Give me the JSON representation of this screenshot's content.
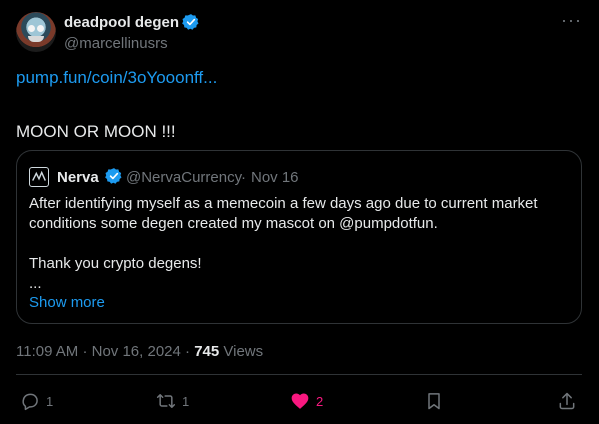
{
  "author": {
    "name": "deadpool degen",
    "handle": "@marcellinusrs"
  },
  "more_menu": "···",
  "tweet": {
    "link": "pump.fun/coin/3oYooonff...",
    "text": "MOON OR MOON !!!"
  },
  "quote": {
    "name": "Nerva",
    "handle": "@NervaCurrency",
    "separator": "·",
    "date": "Nov 16",
    "lines": [
      "After identifying myself as a memecoin a few days ago due to current market",
      "conditions some degen created my mascot on @pumpdotfun.",
      "",
      "Thank you crypto degens!",
      "..."
    ],
    "show_more": "Show more"
  },
  "meta": {
    "time": "11:09 AM",
    "separator": "·",
    "date": "Nov 16, 2024",
    "separator2": "·",
    "views_count": "745",
    "views_label": "Views"
  },
  "actions": {
    "reply_count": "1",
    "retweet_count": "1",
    "like_count": "2"
  },
  "colors": {
    "background": "#000000",
    "accent": "#1d9bf0",
    "like": "#f91880",
    "muted": "#71767b"
  }
}
